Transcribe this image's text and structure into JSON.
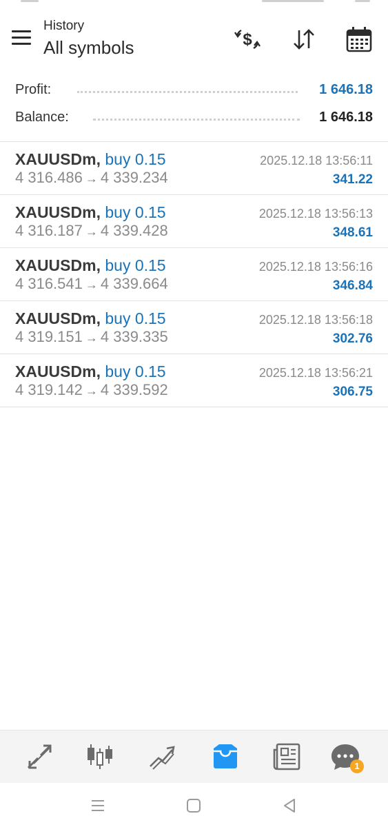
{
  "header": {
    "title_small": "History",
    "title_big": "All symbols",
    "icons": [
      "menu-icon",
      "currency-exchange-icon",
      "sort-icon",
      "calendar-icon"
    ]
  },
  "summary": {
    "profit_label": "Profit:",
    "profit_value": "1 646.18",
    "balance_label": "Balance:",
    "balance_value": "1 646.18"
  },
  "deals": [
    {
      "symbol": "XAUUSDm",
      "type": "buy 0.15",
      "open_price": "4 316.486",
      "close_price": "4 339.234",
      "time": "2025.12.18 13:56:11",
      "profit": "341.22"
    },
    {
      "symbol": "XAUUSDm",
      "type": "buy 0.15",
      "open_price": "4 316.187",
      "close_price": "4 339.428",
      "time": "2025.12.18 13:56:13",
      "profit": "348.61"
    },
    {
      "symbol": "XAUUSDm",
      "type": "buy 0.15",
      "open_price": "4 316.541",
      "close_price": "4 339.664",
      "time": "2025.12.18 13:56:16",
      "profit": "346.84"
    },
    {
      "symbol": "XAUUSDm",
      "type": "buy 0.15",
      "open_price": "4 319.151",
      "close_price": "4 339.335",
      "time": "2025.12.18 13:56:18",
      "profit": "302.76"
    },
    {
      "symbol": "XAUUSDm",
      "type": "buy 0.15",
      "open_price": "4 319.142",
      "close_price": "4 339.592",
      "time": "2025.12.18 13:56:21",
      "profit": "306.75"
    }
  ],
  "bottom_nav": {
    "items": [
      "quotes-icon",
      "chart-icon",
      "trade-icon",
      "history-icon",
      "news-icon",
      "messages-icon"
    ],
    "active": "history-icon",
    "messages_badge": "1"
  },
  "colors": {
    "accent": "#1a73b8",
    "profit_positive": "#1a73b8",
    "text_dark": "#333333",
    "text_muted": "#8a8a8a",
    "nav_active": "#2196f3",
    "badge": "#f5a623"
  }
}
